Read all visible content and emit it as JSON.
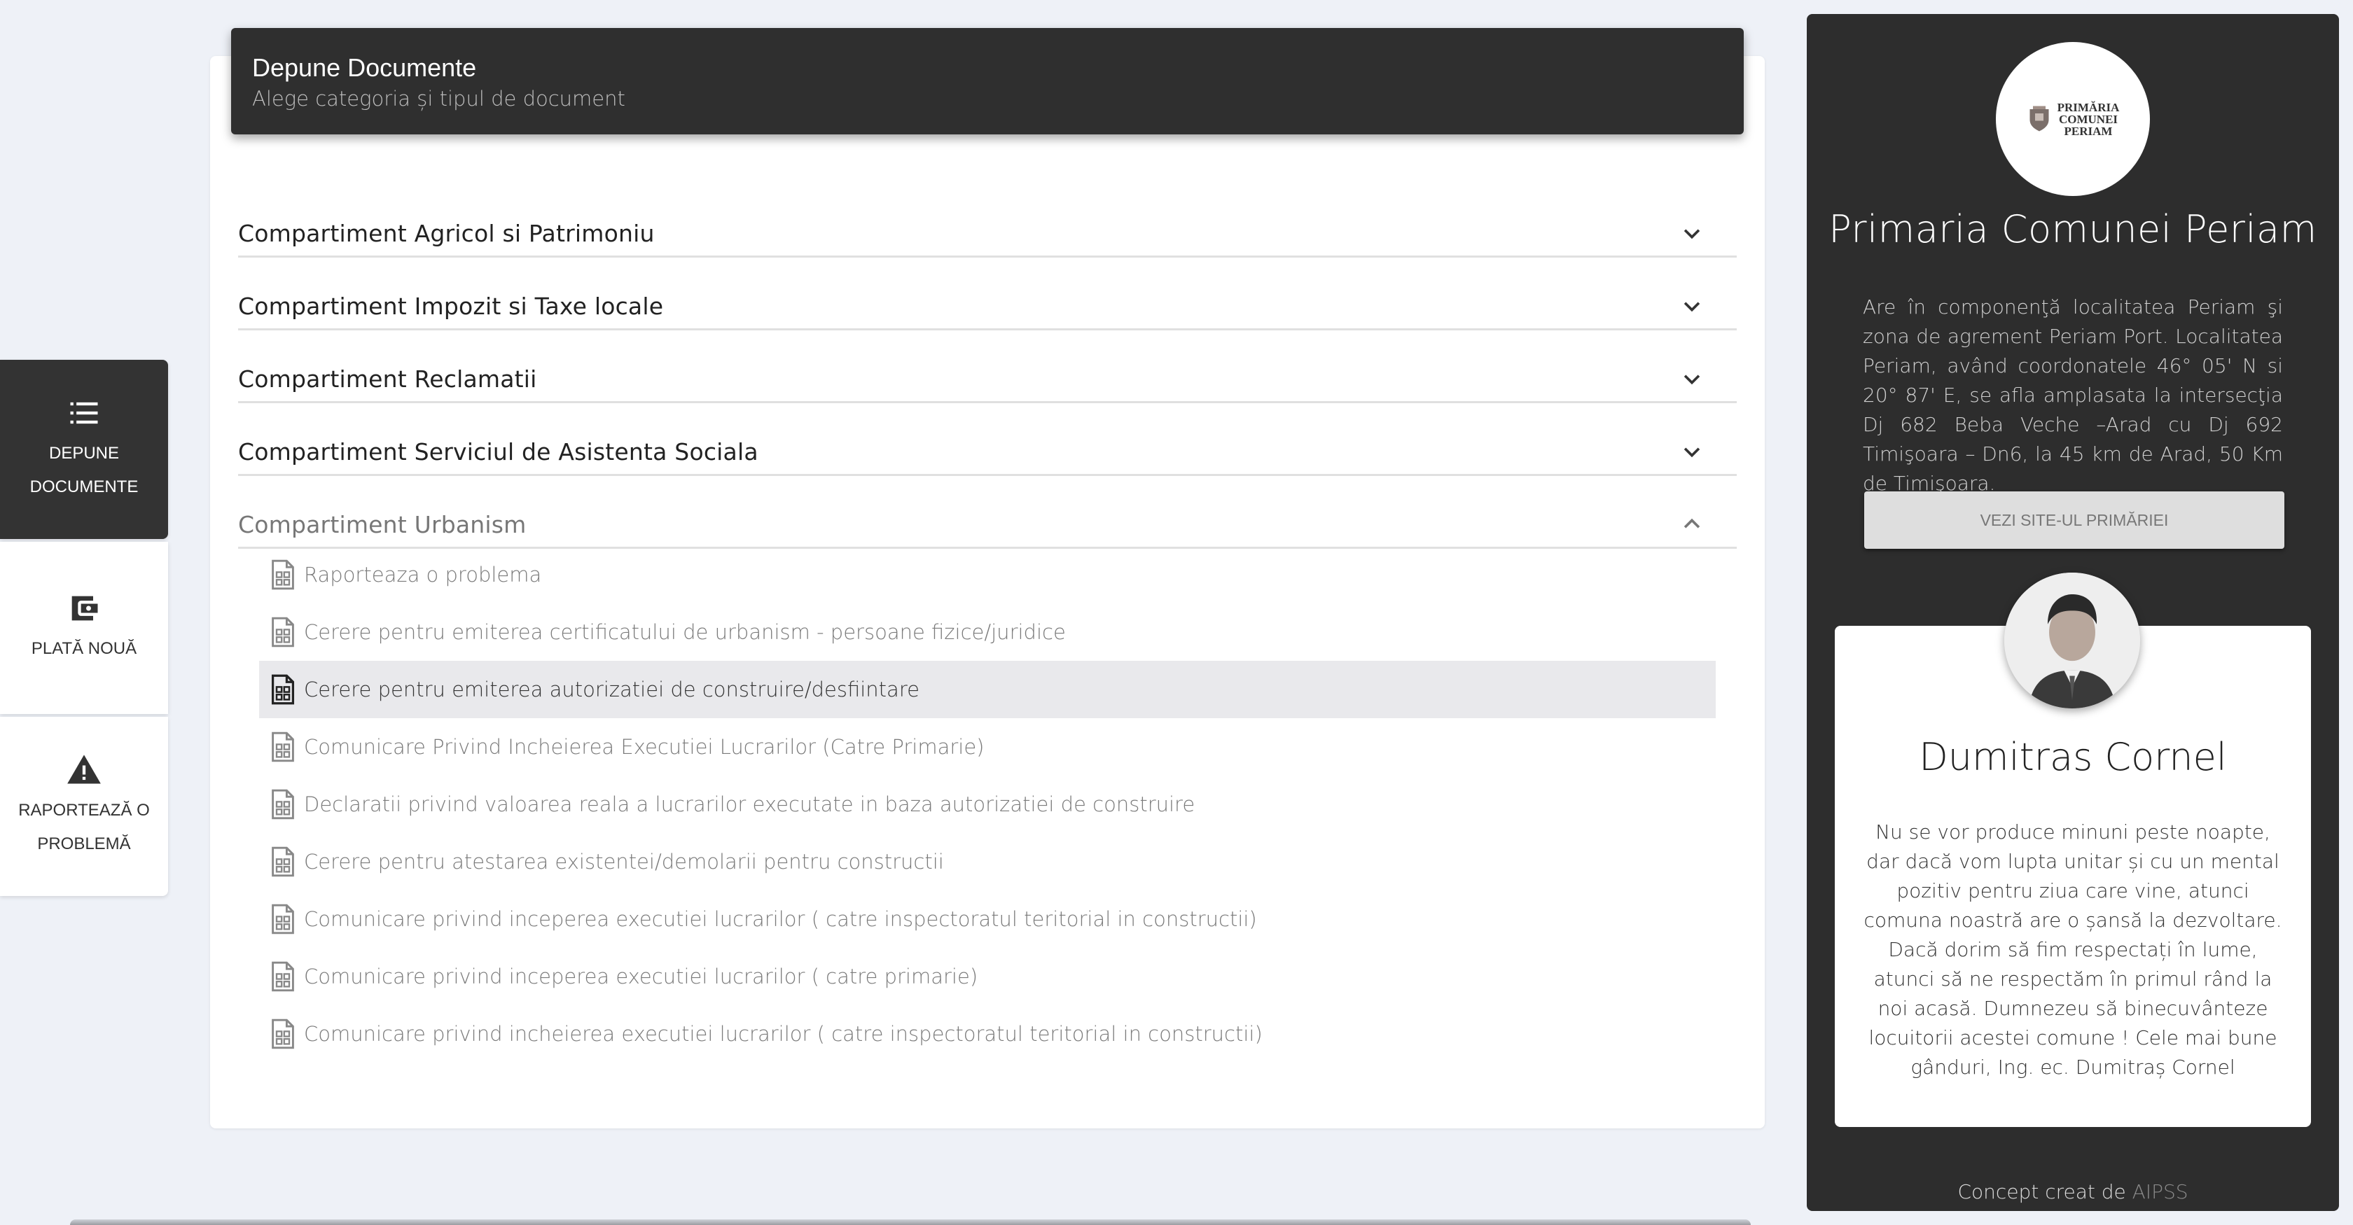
{
  "nav": {
    "items": [
      {
        "label": "DEPUNE DOCUMENTE",
        "icon": "list-icon",
        "active": true
      },
      {
        "label": "PLATĂ NOUĂ",
        "icon": "wallet-icon",
        "active": false
      },
      {
        "label": "RAPORTEAZĂ O PROBLEMĂ",
        "icon": "warning-icon",
        "active": false
      }
    ]
  },
  "header": {
    "title": "Depune Documente",
    "subtitle": "Alege categoria și tipul de document"
  },
  "categories": [
    {
      "label": "Compartiment Agricol si Patrimoniu",
      "open": false
    },
    {
      "label": "Compartiment Impozit si Taxe locale",
      "open": false
    },
    {
      "label": "Compartiment Reclamatii",
      "open": false
    },
    {
      "label": "Compartiment Serviciul de Asistenta Sociala",
      "open": false
    },
    {
      "label": "Compartiment Urbanism",
      "open": true
    }
  ],
  "documents": [
    "Raporteaza o problema",
    "Cerere pentru emiterea certificatului de urbanism - persoane fizice/juridice",
    "Cerere pentru emiterea autorizatiei de construire/desfiintare",
    "Comunicare Privind Incheierea Executiei Lucrarilor (Catre Primarie)",
    "Declaratii privind valoarea reala a lucrarilor executate in baza autorizatiei de construire",
    "Cerere pentru atestarea existentei/demolarii pentru constructii",
    "Comunicare privind inceperea executiei lucrarilor ( catre inspectoratul teritorial in constructii)",
    "Comunicare privind inceperea executiei lucrarilor ( catre primarie)",
    "Comunicare privind incheierea executiei lucrarilor ( catre inspectoratul teritorial in constructii)"
  ],
  "panel": {
    "logo_lines": [
      "PRIMĂRIA",
      "COMUNEI",
      "PERIAM"
    ],
    "name": "Primaria Comunei Periam",
    "description": "Are în componenţă localitatea Periam şi zona de agrement Periam Port. Localitatea Periam, având coordonatele 46° 05' N si 20° 87' E, se afla amplasata la intersecţia Dj 682 Beba Veche –Arad cu Dj 692 Timişoara – Dn6, la 45 km de Arad, 50 Km de Timişoara.",
    "site_button": "VEZI SITE-UL PRIMĂRIEI",
    "mayor_name": "Dumitras Cornel",
    "mayor_quote": "Nu se vor produce minuni peste noapte, dar dacă vom lupta unitar și cu un mental pozitiv pentru ziua care vine, atunci comuna noastră are o șansă la dezvoltare. Dacă dorim să fim respectați în lume, atunci să ne respectăm în primul rând la noi acasă. Dumnezeu să binecuvânteze locuitorii acestei comune ! Cele mai bune gânduri, Ing. ec. Dumitraș Cornel",
    "footer_prefix": "Concept creat de ",
    "footer_link": "AIPSS"
  },
  "colors": {
    "dark": "#2d2d2d",
    "background": "#eef1f7",
    "highlight_row": "#e9e9ec"
  }
}
